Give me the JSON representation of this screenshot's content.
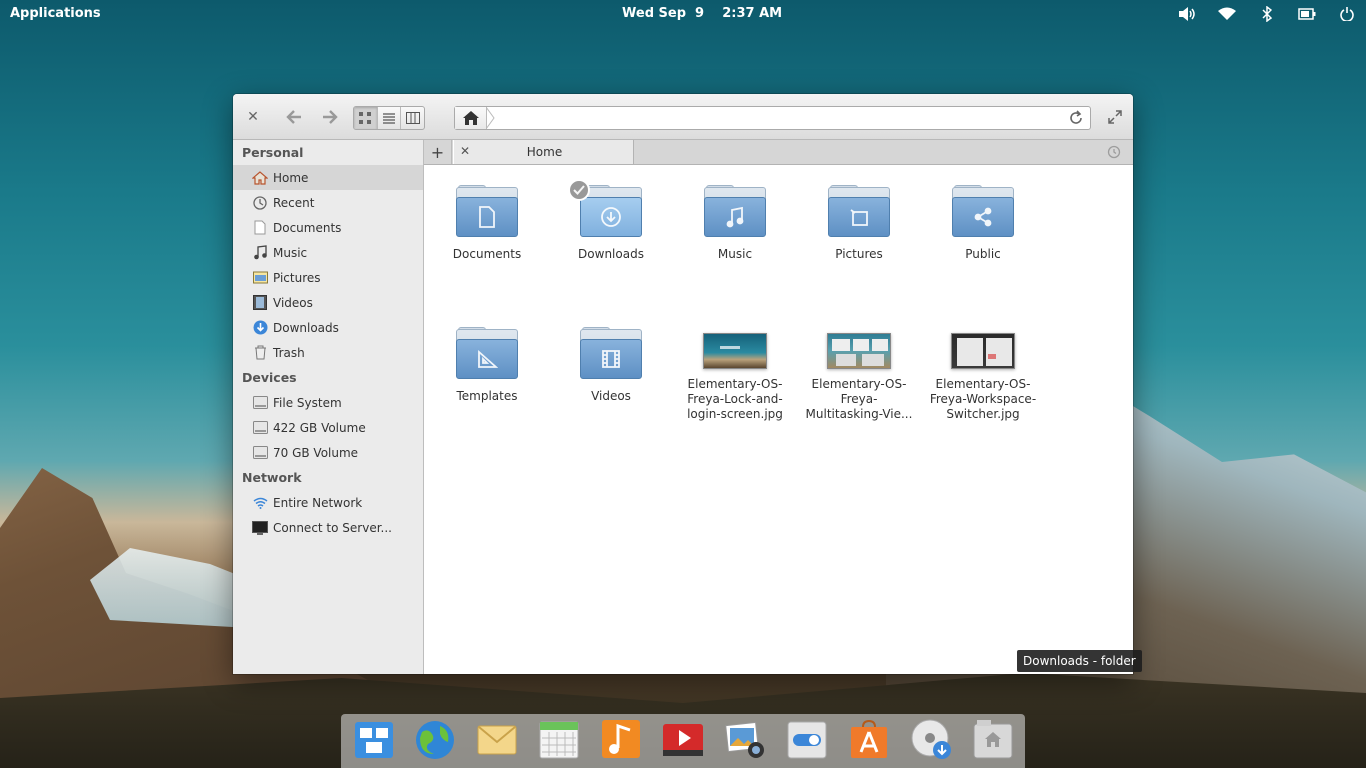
{
  "panel": {
    "applications_label": "Applications",
    "clock": "Wed Sep  9    2:37 AM",
    "indicators": [
      "volume-icon",
      "wifi-icon",
      "bluetooth-icon",
      "battery-icon",
      "power-icon"
    ]
  },
  "window": {
    "tab_label": "Home",
    "path_placeholder": ""
  },
  "sidebar": {
    "sections": [
      {
        "heading": "Personal",
        "items": [
          "Home",
          "Recent",
          "Documents",
          "Music",
          "Pictures",
          "Videos",
          "Downloads",
          "Trash"
        ]
      },
      {
        "heading": "Devices",
        "items": [
          "File System",
          "422 GB Volume",
          "70 GB Volume"
        ]
      },
      {
        "heading": "Network",
        "items": [
          "Entire Network",
          "Connect to Server..."
        ]
      }
    ],
    "selected": "Home"
  },
  "content": {
    "items": [
      {
        "label": "Documents",
        "type": "folder",
        "icon": "document-icon"
      },
      {
        "label": "Downloads",
        "type": "folder",
        "icon": "download-icon",
        "selected": true
      },
      {
        "label": "Music",
        "type": "folder",
        "icon": "music-note-icon"
      },
      {
        "label": "Pictures",
        "type": "folder",
        "icon": "picture-icon"
      },
      {
        "label": "Public",
        "type": "folder",
        "icon": "share-icon"
      },
      {
        "label": "Templates",
        "type": "folder",
        "icon": "ruler-triangle-icon"
      },
      {
        "label": "Videos",
        "type": "folder",
        "icon": "film-icon"
      },
      {
        "label": "Elementary-OS-Freya-Lock-and-login-screen.jpg",
        "label_lines": [
          "Elementary-OS-",
          "Freya-Lock-and-",
          "login-screen.jpg"
        ],
        "type": "image"
      },
      {
        "label": "Elementary-OS-Freya-Multitasking-Vie...",
        "label_lines": [
          "Elementary-OS-",
          "Freya-",
          "Multitasking-Vie..."
        ],
        "type": "image"
      },
      {
        "label": "Elementary-OS-Freya-Workspace-Switcher.jpg",
        "label_lines": [
          "Elementary-OS-",
          "Freya-Workspace-",
          "Switcher.jpg"
        ],
        "type": "image"
      }
    ]
  },
  "tooltip": "Downloads - folder",
  "dock": {
    "apps": [
      "multitasking-view-icon",
      "web-browser-icon",
      "mail-icon",
      "calendar-icon",
      "music-icon",
      "videos-icon",
      "photos-icon",
      "settings-icon",
      "app-center-icon",
      "disk-download-icon",
      "files-icon"
    ]
  }
}
